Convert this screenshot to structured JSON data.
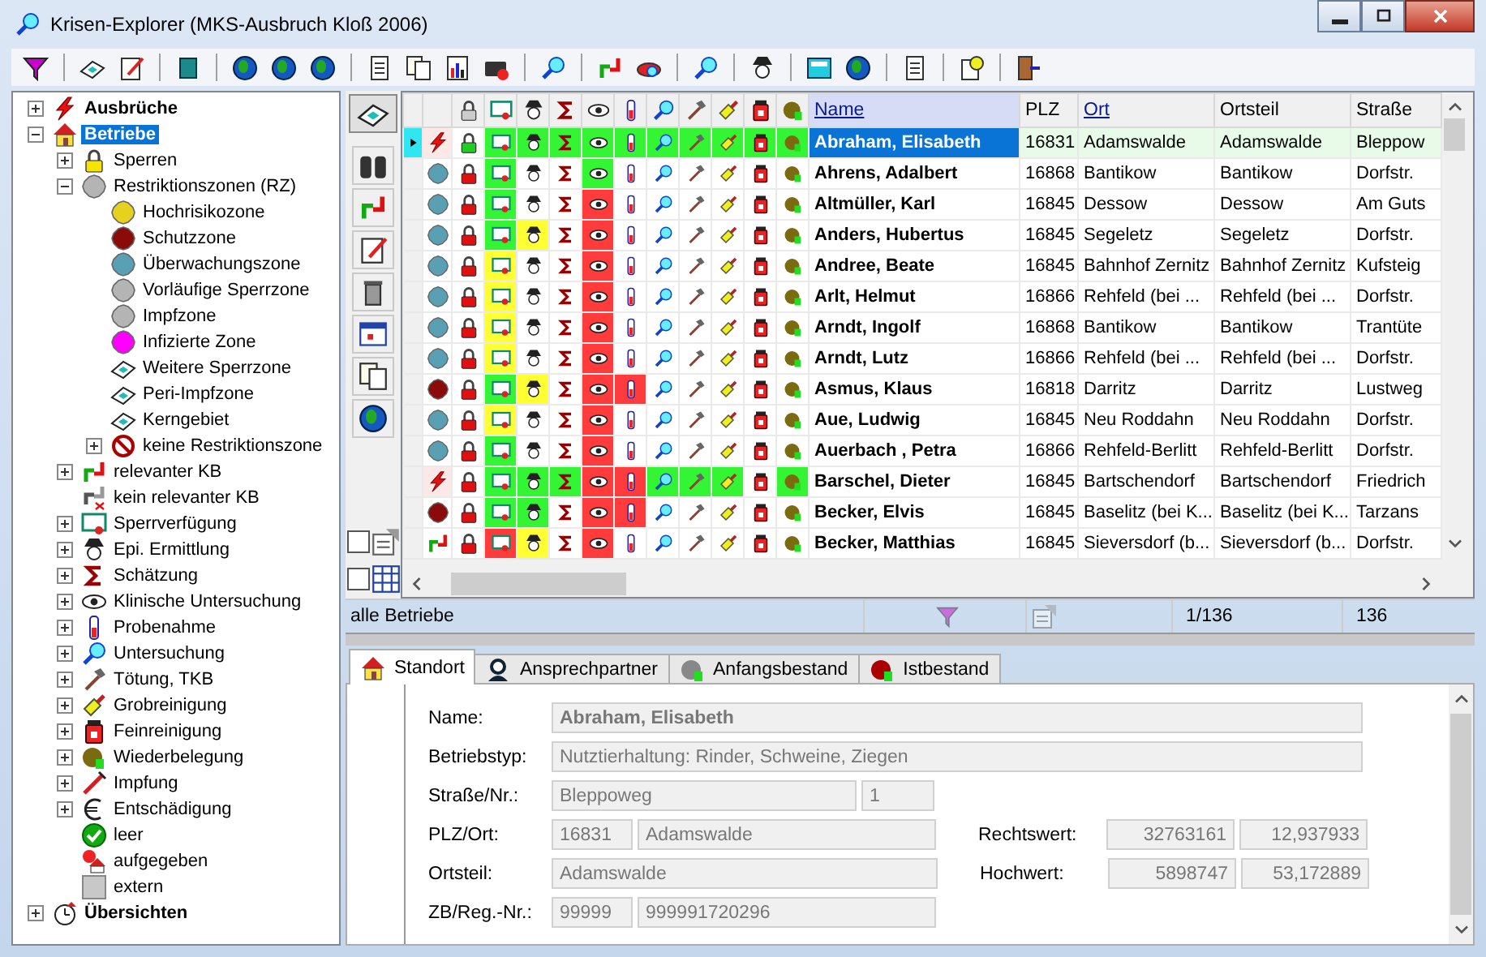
{
  "window": {
    "title": "Krisen-Explorer  (MKS-Ausbruch Kloß 2006)"
  },
  "tree": [
    {
      "label": "Ausbrüche",
      "kind": "lightning",
      "expanded": false,
      "selected": false
    },
    {
      "label": "Betriebe",
      "kind": "house",
      "expanded": true,
      "selected": true,
      "children": [
        {
          "label": "Sperren",
          "kind": "padlock",
          "expanded": false,
          "selected": false
        },
        {
          "label": "Restriktionszonen (RZ)",
          "kind": "blob",
          "color": "#b4b4b4",
          "expanded": true,
          "selected": false,
          "children": [
            {
              "label": "Hochrisikozone",
              "kind": "blob",
              "color": "#e6d21e",
              "selected": false
            },
            {
              "label": "Schutzzone",
              "kind": "blob",
              "color": "#8b0a0a",
              "selected": false
            },
            {
              "label": "Überwachungszone",
              "kind": "blob",
              "color": "#5aa0b4",
              "selected": false
            },
            {
              "label": "Vorläufige Sperrzone",
              "kind": "blob",
              "color": "#b4b4b4",
              "selected": false
            },
            {
              "label": "Impfzone",
              "kind": "blob",
              "color": "#b4b4b4",
              "selected": false
            },
            {
              "label": "Infizierte Zone",
              "kind": "blob",
              "color": "#ff00ff",
              "selected": false
            },
            {
              "label": "Weitere Sperrzone",
              "kind": "map",
              "selected": false
            },
            {
              "label": "Peri-Impfzone",
              "kind": "map",
              "selected": false
            },
            {
              "label": "Kerngebiet",
              "kind": "map",
              "selected": false
            },
            {
              "label": "keine Restriktionszone",
              "kind": "no-entry",
              "expanded": false,
              "selected": false
            }
          ]
        },
        {
          "label": "relevanter KB",
          "kind": "arrows",
          "expanded": false,
          "selected": false
        },
        {
          "label": "kein relevanter KB",
          "kind": "arrows-cross",
          "selected": false
        },
        {
          "label": "Sperrverfügung",
          "kind": "certificate",
          "expanded": false,
          "selected": false
        },
        {
          "label": "Epi. Ermittlung",
          "kind": "detective",
          "expanded": false,
          "selected": false
        },
        {
          "label": "Schätzung",
          "kind": "sigma",
          "expanded": false,
          "selected": false
        },
        {
          "label": "Klinische Untersuchung",
          "kind": "eye",
          "expanded": false,
          "selected": false
        },
        {
          "label": "Probenahme",
          "kind": "test-tube",
          "expanded": false,
          "selected": false
        },
        {
          "label": "Untersuchung",
          "kind": "magnifier",
          "expanded": false,
          "selected": false
        },
        {
          "label": "Tötung, TKB",
          "kind": "hammer",
          "expanded": false,
          "selected": false
        },
        {
          "label": "Grobreinigung",
          "kind": "brush",
          "expanded": false,
          "selected": false
        },
        {
          "label": "Feinreinigung",
          "kind": "jar",
          "expanded": false,
          "selected": false
        },
        {
          "label": "Wiederbelegung",
          "kind": "head",
          "expanded": false,
          "selected": false
        },
        {
          "label": "Impfung",
          "kind": "syringe",
          "expanded": false,
          "selected": false
        },
        {
          "label": "Entschädigung",
          "kind": "euro",
          "expanded": false,
          "selected": false
        },
        {
          "label": "leer",
          "kind": "check",
          "selected": false
        },
        {
          "label": "aufgegeben",
          "kind": "house-badge",
          "selected": false
        },
        {
          "label": "extern",
          "kind": "square",
          "selected": false
        }
      ]
    },
    {
      "label": "Übersichten",
      "kind": "clock-house",
      "expanded": false,
      "selected": false
    }
  ],
  "side_toggles": [
    {
      "checked": false
    },
    {
      "checked": false
    }
  ],
  "columns": [
    {
      "label": "Name",
      "linked": true,
      "sorted": true
    },
    {
      "label": "PLZ",
      "linked": false,
      "sorted": false
    },
    {
      "label": "Ort",
      "linked": true,
      "sorted": false
    },
    {
      "label": "Ortsteil",
      "linked": false,
      "sorted": false
    },
    {
      "label": "Straße",
      "linked": false,
      "sorted": false
    }
  ],
  "rows": [
    {
      "selected": true,
      "kind": "outbreak",
      "lock": {
        "color": "#22cc22"
      },
      "cells": [
        {
          "color": "#33f533"
        },
        {
          "color": "#33f533"
        },
        {
          "color": "#33f533"
        },
        {
          "color": "#33f533"
        },
        {
          "color": "#33f533"
        },
        {
          "color": "#33f533"
        },
        {
          "color": "#33f533"
        },
        {
          "color": "#33f533"
        },
        {
          "color": "#33f533"
        },
        {
          "color": "#33f533"
        }
      ],
      "name": "Abraham, Elisabeth",
      "plz": "16831",
      "ort": "Adamswalde",
      "ortsteil": "Adamswalde",
      "strasse": "Bleppow"
    },
    {
      "selected": false,
      "kind": "surveillance-zone",
      "lock": {
        "color": "#e01010"
      },
      "cells": [
        {
          "color": "#33f533"
        },
        {
          "color": "#ffffff"
        },
        {
          "color": "#ffffff"
        },
        {
          "color": "#33f533"
        },
        {
          "color": "#ffffff"
        },
        {
          "color": "#ffffff"
        },
        {
          "color": "#ffffff"
        },
        {
          "color": "#ffffff"
        },
        {
          "color": "#ffffff"
        },
        {
          "color": "#ffffff"
        }
      ],
      "name": "Ahrens, Adalbert",
      "plz": "16868",
      "ort": "Bantikow",
      "ortsteil": "Bantikow",
      "strasse": "Dorfstr."
    },
    {
      "selected": false,
      "kind": "surveillance-zone",
      "lock": {
        "color": "#e01010"
      },
      "cells": [
        {
          "color": "#33f533"
        },
        {
          "color": "#ffffff"
        },
        {
          "color": "#ffffff"
        },
        {
          "color": "#ff3b3b"
        },
        {
          "color": "#ffffff"
        },
        {
          "color": "#ffffff"
        },
        {
          "color": "#ffffff"
        },
        {
          "color": "#ffffff"
        },
        {
          "color": "#ffffff"
        },
        {
          "color": "#ffffff"
        }
      ],
      "name": "Altmüller, Karl",
      "plz": "16845",
      "ort": "Dessow",
      "ortsteil": "Dessow",
      "strasse": "Am Guts"
    },
    {
      "selected": false,
      "kind": "surveillance-zone",
      "lock": {
        "color": "#e01010"
      },
      "cells": [
        {
          "color": "#33f533"
        },
        {
          "color": "#ffff33"
        },
        {
          "color": "#ffffff"
        },
        {
          "color": "#ff3b3b"
        },
        {
          "color": "#ffffff"
        },
        {
          "color": "#ffffff"
        },
        {
          "color": "#ffffff"
        },
        {
          "color": "#ffffff"
        },
        {
          "color": "#ffffff"
        },
        {
          "color": "#ffffff"
        }
      ],
      "name": "Anders, Hubertus",
      "plz": "16845",
      "ort": "Segeletz",
      "ortsteil": "Segeletz",
      "strasse": "Dorfstr."
    },
    {
      "selected": false,
      "kind": "surveillance-zone",
      "lock": {
        "color": "#e01010"
      },
      "cells": [
        {
          "color": "#ffff33"
        },
        {
          "color": "#ffffff"
        },
        {
          "color": "#ffffff"
        },
        {
          "color": "#ff3b3b"
        },
        {
          "color": "#ffffff"
        },
        {
          "color": "#ffffff"
        },
        {
          "color": "#ffffff"
        },
        {
          "color": "#ffffff"
        },
        {
          "color": "#ffffff"
        },
        {
          "color": "#ffffff"
        }
      ],
      "name": "Andree, Beate",
      "plz": "16845",
      "ort": "Bahnhof Zernitz",
      "ortsteil": "Bahnhof Zernitz",
      "strasse": "Kufsteig"
    },
    {
      "selected": false,
      "kind": "surveillance-zone",
      "lock": {
        "color": "#e01010"
      },
      "cells": [
        {
          "color": "#ffff33"
        },
        {
          "color": "#ffffff"
        },
        {
          "color": "#ffffff"
        },
        {
          "color": "#ff3b3b"
        },
        {
          "color": "#ffffff"
        },
        {
          "color": "#ffffff"
        },
        {
          "color": "#ffffff"
        },
        {
          "color": "#ffffff"
        },
        {
          "color": "#ffffff"
        },
        {
          "color": "#ffffff"
        }
      ],
      "name": "Arlt, Helmut",
      "plz": "16866",
      "ort": "Rehfeld (bei ...",
      "ortsteil": "Rehfeld (bei ...",
      "strasse": "Dorfstr."
    },
    {
      "selected": false,
      "kind": "surveillance-zone",
      "lock": {
        "color": "#e01010"
      },
      "cells": [
        {
          "color": "#ffff33"
        },
        {
          "color": "#ffffff"
        },
        {
          "color": "#ffffff"
        },
        {
          "color": "#ff3b3b"
        },
        {
          "color": "#ffffff"
        },
        {
          "color": "#ffffff"
        },
        {
          "color": "#ffffff"
        },
        {
          "color": "#ffffff"
        },
        {
          "color": "#ffffff"
        },
        {
          "color": "#ffffff"
        }
      ],
      "name": "Arndt, Ingolf",
      "plz": "16868",
      "ort": "Bantikow",
      "ortsteil": "Bantikow",
      "strasse": "Trantüte"
    },
    {
      "selected": false,
      "kind": "surveillance-zone",
      "lock": {
        "color": "#e01010"
      },
      "cells": [
        {
          "color": "#ffff33"
        },
        {
          "color": "#ffffff"
        },
        {
          "color": "#ffffff"
        },
        {
          "color": "#ff3b3b"
        },
        {
          "color": "#ffffff"
        },
        {
          "color": "#ffffff"
        },
        {
          "color": "#ffffff"
        },
        {
          "color": "#ffffff"
        },
        {
          "color": "#ffffff"
        },
        {
          "color": "#ffffff"
        }
      ],
      "name": "Arndt, Lutz",
      "plz": "16866",
      "ort": "Rehfeld (bei ...",
      "ortsteil": "Rehfeld (bei ...",
      "strasse": "Dorfstr."
    },
    {
      "selected": false,
      "kind": "protection-zone",
      "lock": {
        "color": "#e01010"
      },
      "cells": [
        {
          "color": "#33f533"
        },
        {
          "color": "#ffff33"
        },
        {
          "color": "#ffffff"
        },
        {
          "color": "#ff3b3b"
        },
        {
          "color": "#ff3b3b"
        },
        {
          "color": "#ffffff"
        },
        {
          "color": "#ffffff"
        },
        {
          "color": "#ffffff"
        },
        {
          "color": "#ffffff"
        },
        {
          "color": "#ffffff"
        }
      ],
      "name": "Asmus, Klaus",
      "plz": "16818",
      "ort": "Darritz",
      "ortsteil": "Darritz",
      "strasse": "Lustweg"
    },
    {
      "selected": false,
      "kind": "surveillance-zone",
      "lock": {
        "color": "#e01010"
      },
      "cells": [
        {
          "color": "#ffff33"
        },
        {
          "color": "#ffffff"
        },
        {
          "color": "#ffffff"
        },
        {
          "color": "#ff3b3b"
        },
        {
          "color": "#ffffff"
        },
        {
          "color": "#ffffff"
        },
        {
          "color": "#ffffff"
        },
        {
          "color": "#ffffff"
        },
        {
          "color": "#ffffff"
        },
        {
          "color": "#ffffff"
        }
      ],
      "name": "Aue, Ludwig",
      "plz": "16845",
      "ort": "Neu Roddahn",
      "ortsteil": "Neu Roddahn",
      "strasse": "Dorfstr."
    },
    {
      "selected": false,
      "kind": "surveillance-zone",
      "lock": {
        "color": "#e01010"
      },
      "cells": [
        {
          "color": "#33f533"
        },
        {
          "color": "#ffffff"
        },
        {
          "color": "#ffffff"
        },
        {
          "color": "#ff3b3b"
        },
        {
          "color": "#ffffff"
        },
        {
          "color": "#ffffff"
        },
        {
          "color": "#ffffff"
        },
        {
          "color": "#ffffff"
        },
        {
          "color": "#ffffff"
        },
        {
          "color": "#ffffff"
        }
      ],
      "name": "Auerbach , Petra",
      "plz": "16866",
      "ort": "Rehfeld-Berlitt",
      "ortsteil": "Rehfeld-Berlitt",
      "strasse": "Dorfstr."
    },
    {
      "selected": false,
      "kind": "outbreak",
      "lock": {
        "color": "#e01010"
      },
      "cells": [
        {
          "color": "#33f533"
        },
        {
          "color": "#33f533"
        },
        {
          "color": "#33f533"
        },
        {
          "color": "#ff3b3b"
        },
        {
          "color": "#ff3b3b"
        },
        {
          "color": "#33f533"
        },
        {
          "color": "#33f533"
        },
        {
          "color": "#33f533"
        },
        {
          "color": "#ffffff"
        },
        {
          "color": "#33f533"
        }
      ],
      "name": "Barschel, Dieter",
      "plz": "16845",
      "ort": "Bartschendorf",
      "ortsteil": "Bartschendorf",
      "strasse": "Friedrich"
    },
    {
      "selected": false,
      "kind": "protection-zone",
      "lock": {
        "color": "#e01010"
      },
      "cells": [
        {
          "color": "#33f533"
        },
        {
          "color": "#33f533"
        },
        {
          "color": "#ffffff"
        },
        {
          "color": "#ff3b3b"
        },
        {
          "color": "#ff3b3b"
        },
        {
          "color": "#ffffff"
        },
        {
          "color": "#ffffff"
        },
        {
          "color": "#ffffff"
        },
        {
          "color": "#ffffff"
        },
        {
          "color": "#ffffff"
        }
      ],
      "name": "Becker, Elvis",
      "plz": "16845",
      "ort": "Baselitz (bei K...",
      "ortsteil": "Baselitz (bei K...",
      "strasse": "Tarzans"
    },
    {
      "selected": false,
      "kind": "relevant-kb",
      "lock": {
        "color": "#e01010"
      },
      "cells": [
        {
          "color": "#ff3b3b"
        },
        {
          "color": "#ffff33"
        },
        {
          "color": "#ffffff"
        },
        {
          "color": "#ff3b3b"
        },
        {
          "color": "#ffffff"
        },
        {
          "color": "#ffffff"
        },
        {
          "color": "#ffffff"
        },
        {
          "color": "#ffffff"
        },
        {
          "color": "#ffffff"
        },
        {
          "color": "#ffffff"
        }
      ],
      "name": "Becker, Matthias",
      "plz": "16845",
      "ort": "Sieversdorf (b...",
      "ortsteil": "Sieversdorf (b...",
      "strasse": "Dorfstr."
    }
  ],
  "status_bar": {
    "label": "alle Betriebe",
    "position": "1/136",
    "count": "136"
  },
  "tabs": [
    {
      "label": "Standort",
      "selected": true
    },
    {
      "label": "Ansprechpartner",
      "selected": false
    },
    {
      "label": "Anfangsbestand",
      "selected": false
    },
    {
      "label": "Istbestand",
      "selected": false
    }
  ],
  "form": [
    {
      "kind": "title",
      "label": "Name:",
      "fields": [
        "Abraham, Elisabeth"
      ]
    },
    {
      "kind": "wide",
      "label": "Betriebstyp:",
      "fields": [
        "Nutztierhaltung: Rinder, Schweine, Ziegen"
      ]
    },
    {
      "kind": "street",
      "label": "Straße/Nr.:",
      "fields": [
        "Bleppoweg",
        "1"
      ]
    },
    {
      "kind": "code",
      "label": "PLZ/Ort:",
      "fields": [
        "16831",
        "Adamswalde"
      ],
      "right": {
        "label": "Rechtswert:",
        "fields": [
          "32763161",
          "12,937933"
        ]
      }
    },
    {
      "kind": "medium",
      "label": "Ortsteil:",
      "fields": [
        "Adamswalde"
      ],
      "right": {
        "label": "Hochwert:",
        "fields": [
          "5898747",
          "53,172889"
        ]
      }
    },
    {
      "kind": "code",
      "label": "ZB/Reg.-Nr.:",
      "fields": [
        "99999",
        "999991720296"
      ]
    }
  ]
}
